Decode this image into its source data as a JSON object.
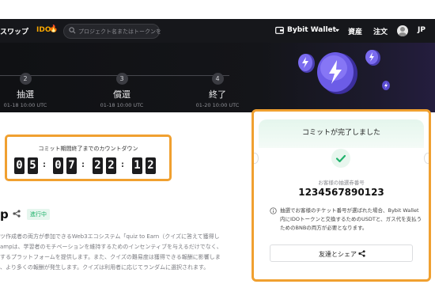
{
  "nav": {
    "swap": "スワップ",
    "ido": "IDO",
    "search_placeholder": "プロジェクト名またはトークンを",
    "wallet": "Bybit Wallet",
    "assets": "資産",
    "orders": "注文",
    "lang": "JP"
  },
  "steps": [
    {
      "num": "2",
      "label": "抽選",
      "date": "01-18 10:00 UTC"
    },
    {
      "num": "3",
      "label": "償還",
      "date": "01-18 10:00 UTC"
    },
    {
      "num": "4",
      "label": "終了",
      "date": "01-20 10:00 UTC"
    }
  ],
  "countdown": {
    "title": "コミット期間終了までのカウントダウン",
    "digits": [
      "0",
      "5",
      "0",
      "7",
      "2",
      "2",
      "1",
      "2"
    ]
  },
  "project": {
    "name": "p",
    "status": "進行中",
    "desc": [
      "ツ作成者の両方が参加できるWeb3エコシステム「quiz to Earn（クイズに答えて獲得し",
      "ampは、学習者のモチベーションを維持するためのインセンティブを与えるだけでなく、",
      "するプラットフォームを提供します。また、クイズの難易度は獲得できる報酬に影響しま",
      "、より多くの報酬が発生します。クイズは利用者に応じてランダムに選択されます。"
    ]
  },
  "card": {
    "title": "コミットが完了しました",
    "ticket_label": "お客様の抽選券番号",
    "ticket_number": "1234567890123",
    "note": "抽選でお客様のチケット番号が選ばれた場合、Bybit Wallet内にIDOトークンと交換するためのUSDTと、ガス代を支払うためのBNBの両方が必要となります。",
    "share_label": "友達とシェア"
  },
  "colors": {
    "highlight": "#f0a030",
    "ido": "#f7a600",
    "success": "#20b26c",
    "token": "#6c5ce7"
  }
}
